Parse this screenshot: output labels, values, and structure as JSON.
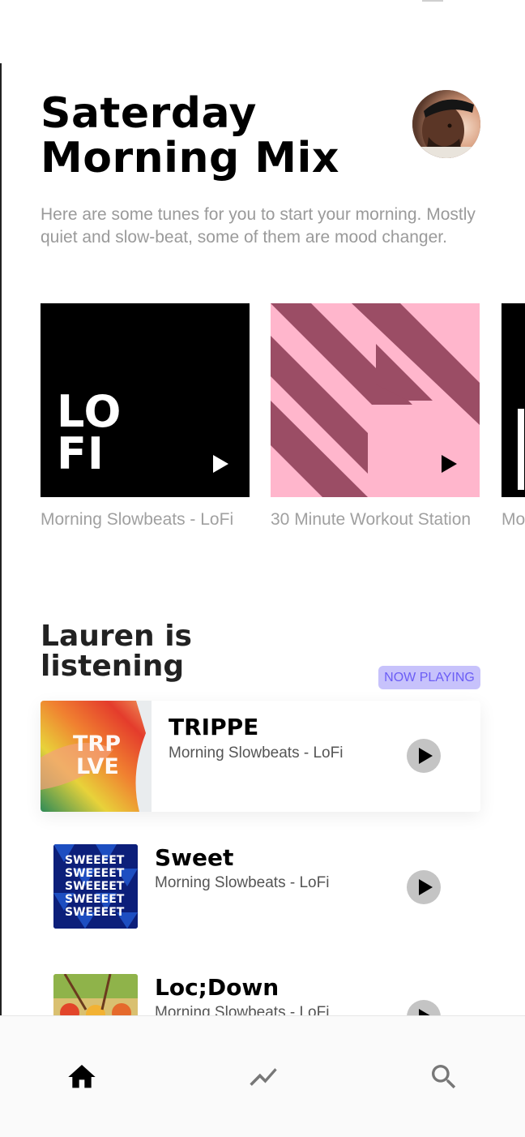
{
  "header": {
    "title": "Saterday Morning Mix",
    "subtitle": "Here are some tunes for you to start your morning. Mostly quiet and slow-beat, some of them are mood changer."
  },
  "playlists": [
    {
      "cover_text_line1": "LO",
      "cover_text_line2": "FI",
      "caption": "Morning Slowbeats - LoFi"
    },
    {
      "caption": "30 Minute Workout Station"
    },
    {
      "caption": "Morning Slowbeats - LoFi"
    }
  ],
  "listening": {
    "title": "Lauren is listening",
    "badge": "NOW PLAYING",
    "tracks": [
      {
        "title": "TRIPPE",
        "subtitle": "Morning Slowbeats - LoFi",
        "art_text": "TRP LVE"
      },
      {
        "title": "Sweet",
        "subtitle": "Morning Slowbeats - LoFi",
        "art_text": "SWEEEET"
      },
      {
        "title": "Loc;Down",
        "subtitle": "Morning Slowbeats - LoFi"
      }
    ]
  },
  "nav": {
    "items": [
      {
        "icon": "home-icon",
        "active": true
      },
      {
        "icon": "trending-icon",
        "active": false
      },
      {
        "icon": "search-icon",
        "active": false
      }
    ]
  },
  "colors": {
    "badge_bg": "#c7c2fb",
    "badge_text": "#6b5df5",
    "workout_pink": "#ffb6cc",
    "workout_plum": "#9b4d65"
  }
}
